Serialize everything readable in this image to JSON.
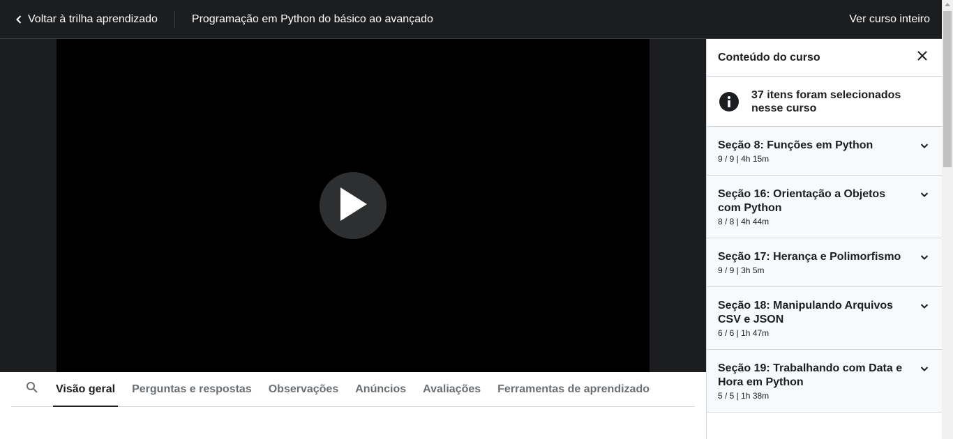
{
  "header": {
    "back_label": "Voltar à trilha aprendizado",
    "course_title": "Programação em Python do básico ao avançado",
    "view_full_label": "Ver curso inteiro"
  },
  "tabs": [
    {
      "label": "Visão geral",
      "active": true
    },
    {
      "label": "Perguntas e respostas",
      "active": false
    },
    {
      "label": "Observações",
      "active": false
    },
    {
      "label": "Anúncios",
      "active": false
    },
    {
      "label": "Avaliações",
      "active": false
    },
    {
      "label": "Ferramentas de aprendizado",
      "active": false
    }
  ],
  "sidebar": {
    "title": "Conteúdo do curso",
    "notice": "37 itens foram selecionados nesse curso",
    "sections": [
      {
        "title": "Seção 8: Funções em Python",
        "meta": "9 / 9 | 4h 15m"
      },
      {
        "title": "Seção 16: Orientação a Objetos com Python",
        "meta": "8 / 8 | 4h 44m"
      },
      {
        "title": "Seção 17: Herança e Polimorfismo",
        "meta": "9 / 9 | 3h 5m"
      },
      {
        "title": "Seção 18: Manipulando Arquivos CSV e JSON",
        "meta": "6 / 6 | 1h 47m"
      },
      {
        "title": "Seção 19: Trabalhando com Data e Hora em Python",
        "meta": "5 / 5 | 1h 38m"
      }
    ]
  },
  "colors": {
    "header_bg": "#1c1d1f",
    "section_bg": "#f7f9fa",
    "video_bg": "#000000"
  }
}
